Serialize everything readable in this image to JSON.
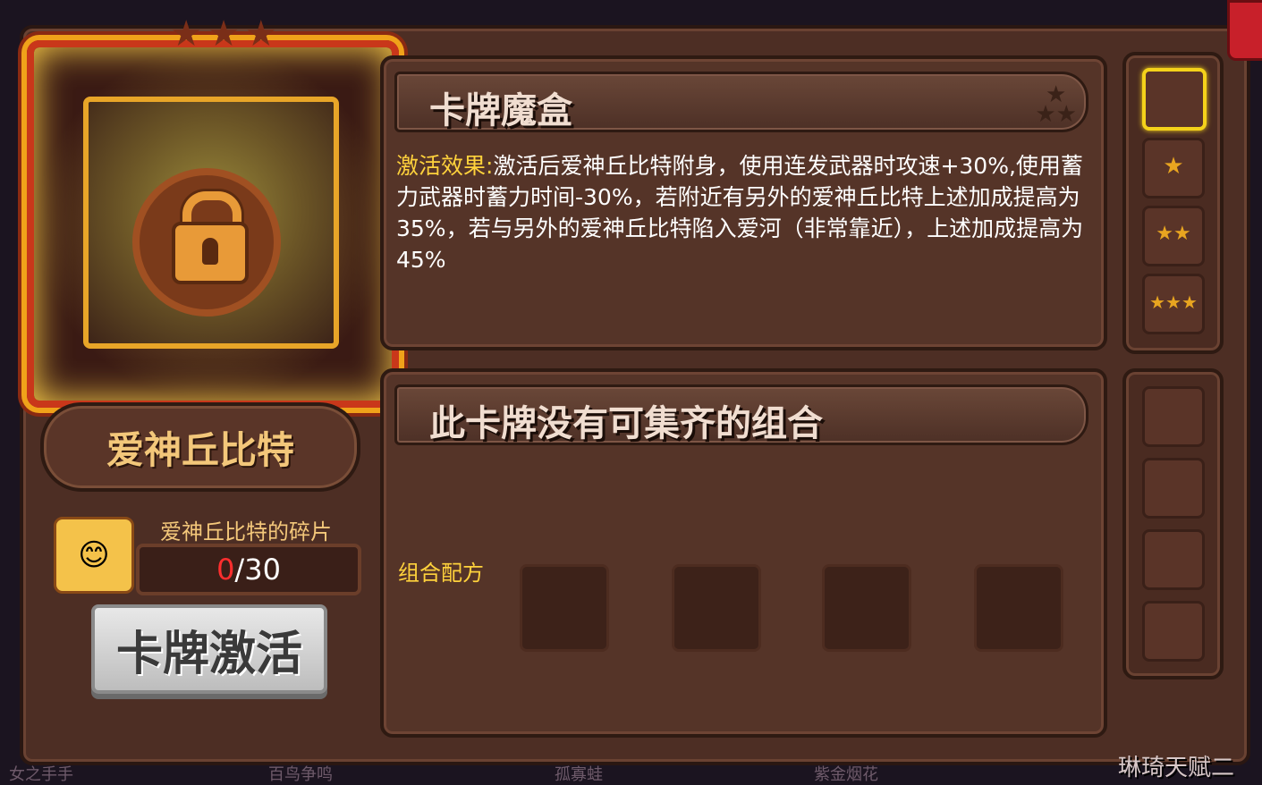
{
  "card": {
    "name": "爱神丘比特",
    "fragment_title": "爱神丘比特的碎片",
    "fragment_current": "0",
    "fragment_total": "/30",
    "activate_label": "卡牌激活",
    "crown_icon": "crown-icon",
    "lock_icon": "lock-icon"
  },
  "effect_panel": {
    "title": "卡牌魔盒",
    "effect_label": "激活效果:",
    "effect_text": "激活后爱神丘比特附身，使用连发武器时攻速+30%,使用蓄力武器时蓄力时间-30%，若附近有另外的爱神丘比特上述加成提高为35%，若与另外的爱神丘比特陷入爱河（非常靠近），上述加成提高为45%"
  },
  "combo_panel": {
    "title": "此卡牌没有可集齐的组合",
    "recipe_label": "组合配方"
  },
  "star_levels": [
    "",
    "★",
    "★★",
    "★★★"
  ],
  "background_labels": [
    "女之手手",
    "百鸟争鸣",
    "孤寡蛙",
    "紫金烟花",
    "琳琦天赋二"
  ],
  "colors": {
    "effect_label": "#ffd23c",
    "fragment_current": "#ff2e2e",
    "selected_border": "#f4d21a"
  }
}
